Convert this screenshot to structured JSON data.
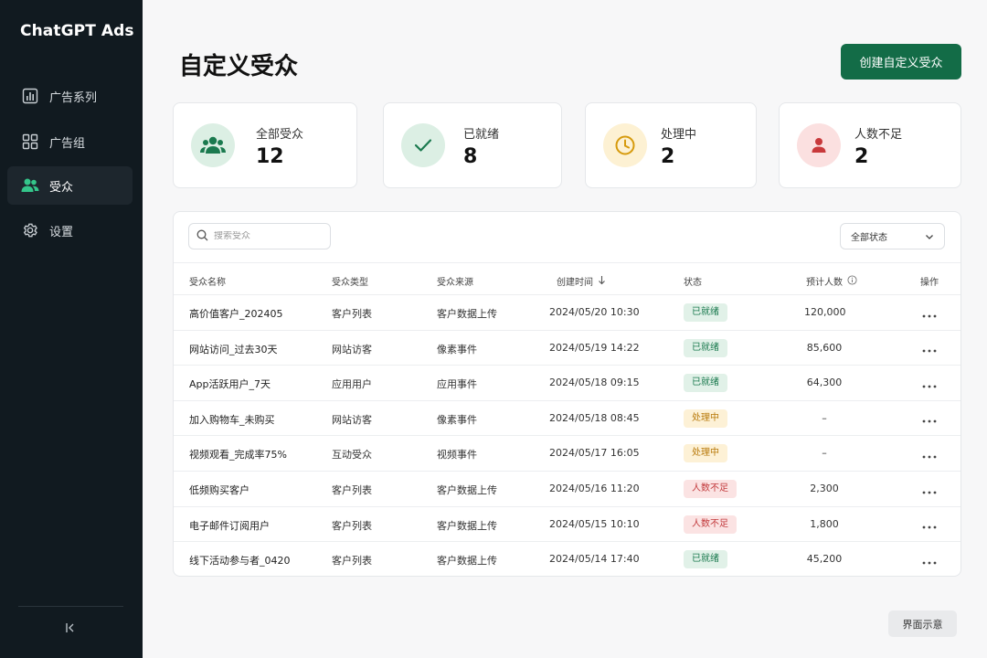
{
  "sidebar": {
    "brand": "ChatGPT Ads",
    "items": [
      {
        "label": "广告系列",
        "icon": "bar-chart-icon"
      },
      {
        "label": "广告组",
        "icon": "grid-icon"
      },
      {
        "label": "受众",
        "icon": "users-icon",
        "active": true
      },
      {
        "label": "设置",
        "icon": "gear-icon"
      }
    ]
  },
  "header": {
    "title": "自定义受众",
    "create_label": "创建自定义受众"
  },
  "stats": [
    {
      "label": "全部受众",
      "value": "12",
      "icon": "users-icon",
      "color": "#1b7a4f",
      "bg": "#dcefe4"
    },
    {
      "label": "已就绪",
      "value": "8",
      "icon": "check-icon",
      "color": "#1b7a4f",
      "bg": "#dcefe4"
    },
    {
      "label": "处理中",
      "value": "2",
      "icon": "clock-icon",
      "color": "#d69a0c",
      "bg": "#fdf1d3"
    },
    {
      "label": "人数不足",
      "value": "2",
      "icon": "person-icon",
      "color": "#c8393b",
      "bg": "#fbe0e0"
    }
  ],
  "table": {
    "search_placeholder": "搜索受众",
    "status_filter": "全部状态",
    "columns": [
      "受众名称",
      "受众类型",
      "受众来源",
      "创建时间",
      "状态",
      "预计人数",
      "操作"
    ],
    "rows": [
      {
        "name": "高价值客户_202405",
        "type": "客户列表",
        "source": "客户数据上传",
        "created": "2024/05/20 10:30",
        "status": "已就绪",
        "size": "120,000"
      },
      {
        "name": "网站访问_过去30天",
        "type": "网站访客",
        "source": "像素事件",
        "created": "2024/05/19 14:22",
        "status": "已就绪",
        "size": "85,600"
      },
      {
        "name": "App活跃用户_7天",
        "type": "应用用户",
        "source": "应用事件",
        "created": "2024/05/18 09:15",
        "status": "已就绪",
        "size": "64,300"
      },
      {
        "name": "加入购物车_未购买",
        "type": "网站访客",
        "source": "像素事件",
        "created": "2024/05/18 08:45",
        "status": "处理中",
        "size": "–"
      },
      {
        "name": "视频观看_完成率75%",
        "type": "互动受众",
        "source": "视频事件",
        "created": "2024/05/17 16:05",
        "status": "处理中",
        "size": "–"
      },
      {
        "name": "低频购买客户",
        "type": "客户列表",
        "source": "客户数据上传",
        "created": "2024/05/16 11:20",
        "status": "人数不足",
        "size": "2,300"
      },
      {
        "name": "电子邮件订阅用户",
        "type": "客户列表",
        "source": "客户数据上传",
        "created": "2024/05/15 10:10",
        "status": "人数不足",
        "size": "1,800"
      },
      {
        "name": "线下活动参与者_0420",
        "type": "客户列表",
        "source": "客户数据上传",
        "created": "2024/05/14 17:40",
        "status": "已就绪",
        "size": "45,200"
      }
    ]
  },
  "status_colors": {
    "已就绪": {
      "bg": "#e1f1e8",
      "fg": "#1b7a4f"
    },
    "处理中": {
      "bg": "#fdf1d6",
      "fg": "#b8790a"
    },
    "人数不足": {
      "bg": "#fbe3e3",
      "fg": "#c23a3c"
    }
  },
  "footer": {
    "demo_label": "界面示意"
  }
}
